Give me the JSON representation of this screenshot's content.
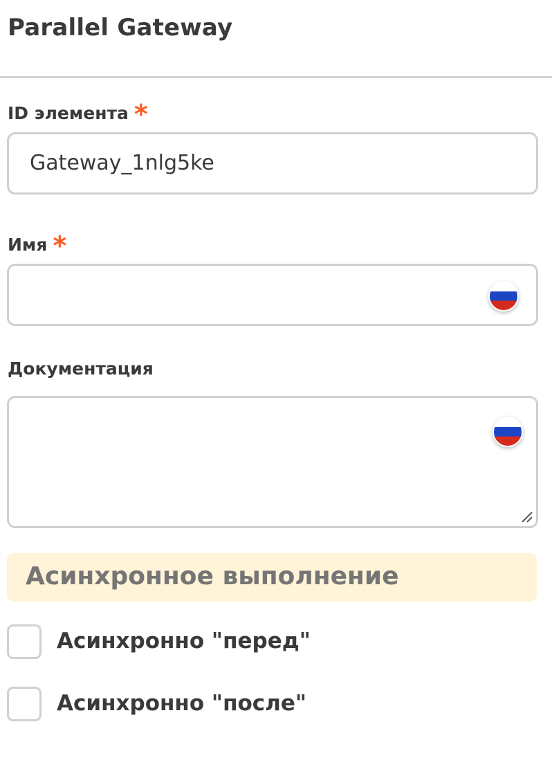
{
  "header": {
    "title": "Parallel Gateway"
  },
  "fields": {
    "element_id": {
      "label": "ID элемента",
      "required_mark": "*",
      "value": "Gateway_1nlg5ke"
    },
    "name": {
      "label": "Имя",
      "required_mark": "*",
      "value": "",
      "language_flag_icon": "russia-flag-icon"
    },
    "documentation": {
      "label": "Документация",
      "value": "",
      "language_flag_icon": "russia-flag-icon",
      "resize_icon": "resize-grip-icon"
    }
  },
  "async_section": {
    "title": "Асинхронное выполнение",
    "background_color": "#fff3d8",
    "options": [
      {
        "label": "Асинхронно \"перед\"",
        "checked": false
      },
      {
        "label": "Асинхронно \"после\"",
        "checked": false
      }
    ]
  },
  "colors": {
    "required_accent": "#ff5a1f",
    "border": "#d0d0d0",
    "text": "#3a3a3a"
  }
}
